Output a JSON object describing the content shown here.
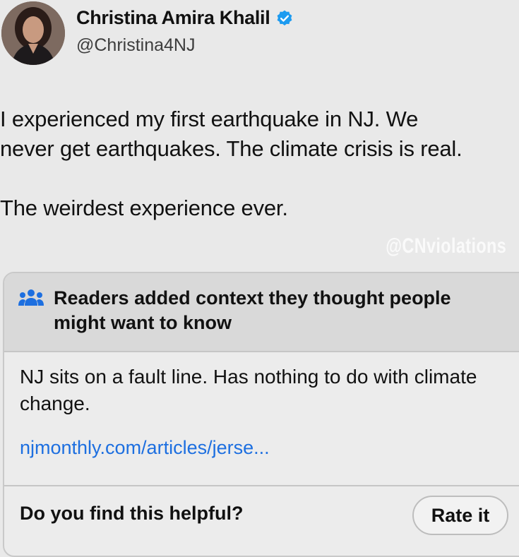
{
  "author": {
    "name": "Christina Amira Khalil",
    "handle": "@Christina4NJ",
    "verified_icon": "verified-badge-icon",
    "accent": "#1d9bf0"
  },
  "tweet": {
    "lines": [
      "I experienced my first earthquake in NJ. We",
      "never get earthquakes. The climate crisis is real."
    ],
    "second_paragraph": "The weirdest experience ever."
  },
  "watermark": "@CNviolations",
  "community_note": {
    "icon": "people-icon",
    "title": "Readers added context they thought people might want to know",
    "body": "NJ sits on a fault line. Has nothing to do with climate change.",
    "link": "njmonthly.com/articles/jerse...",
    "link_color": "#1d6fe0",
    "helpful_prompt": "Do you find this helpful?",
    "rate_label": "Rate it"
  }
}
